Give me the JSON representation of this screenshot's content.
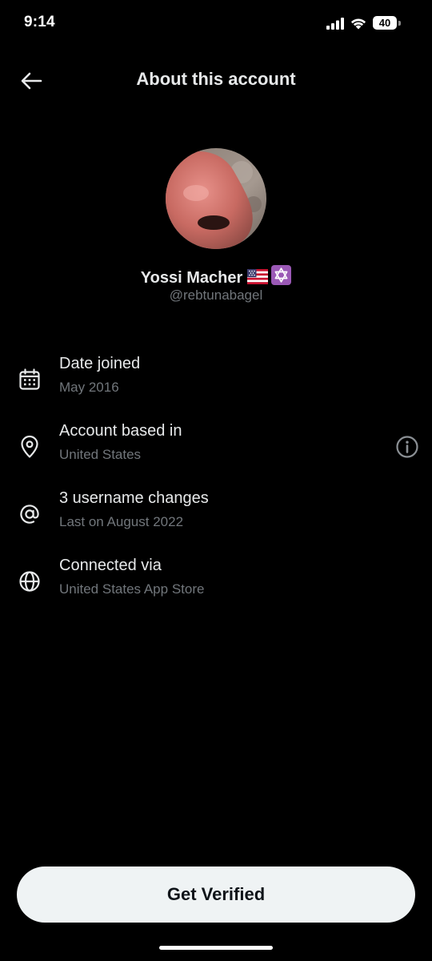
{
  "status_bar": {
    "time": "9:14",
    "battery": "40"
  },
  "header": {
    "title": "About this account",
    "back_icon": "arrow-left-icon"
  },
  "profile": {
    "avatar_icon": "profile-photo",
    "name": "Yossi Macher",
    "badges": [
      "us-flag-icon",
      "star-of-david-icon"
    ],
    "handle": "@rebtunabagel"
  },
  "details": [
    {
      "icon": "calendar-icon",
      "title": "Date joined",
      "subtitle": "May 2016"
    },
    {
      "icon": "location-pin-icon",
      "title": "Account based in",
      "subtitle": "United States",
      "trailing_icon": "info-circle-icon"
    },
    {
      "icon": "at-sign-icon",
      "title": "3 username changes",
      "subtitle": "Last on August 2022"
    },
    {
      "icon": "globe-icon",
      "title": "Connected via",
      "subtitle": "United States App Store"
    }
  ],
  "footer": {
    "cta_label": "Get Verified"
  },
  "colors": {
    "background": "#000000",
    "primary_text": "#e7e9ea",
    "secondary_text": "#71767b",
    "button_bg": "#eff3f4",
    "button_text": "#0f1419"
  }
}
